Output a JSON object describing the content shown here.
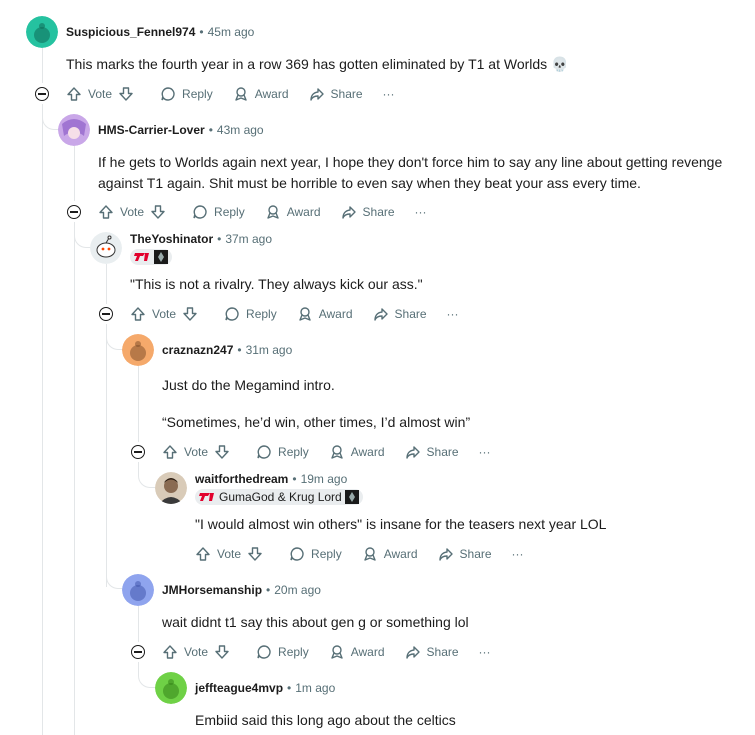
{
  "labels": {
    "vote": "Vote",
    "reply": "Reply",
    "award": "Award",
    "share": "Share",
    "more": "···"
  },
  "comments": [
    {
      "user": "Suspicious_Fennel974",
      "sep": "•",
      "time": "45m ago",
      "text": "This marks the fourth year in a row 369 has gotten eliminated by T1 at Worlds 💀",
      "avatar_color": "#25c2a0"
    },
    {
      "user": "HMS-Carrier-Lover",
      "sep": "•",
      "time": "43m ago",
      "text": "If he gets to Worlds again next year, I hope they don't force him to say any line about getting revenge against T1 again. Shit must be horrible to even say when they beat your ass every time.",
      "avatar_color": "#c9a7e8"
    },
    {
      "user": "TheYoshinator",
      "sep": "•",
      "time": "37m ago",
      "text": "\"This is not a rivalry. They always kick our ass.\"",
      "avatar_color": "#e9eef0"
    },
    {
      "user": "craznazn247",
      "sep": "•",
      "time": "31m ago",
      "text1": "Just do the Megamind intro.",
      "text2": "“Sometimes, he’d win, other times, I’d almost win”",
      "avatar_color": "#f5a96b"
    },
    {
      "user": "waitforthedream",
      "sep": "•",
      "time": "19m ago",
      "flair": "GumaGod & Krug Lord",
      "text": "\"I would almost win others\" is insane for the teasers next year LOL",
      "avatar_color": "#8a6b52"
    },
    {
      "user": "JMHorsemanship",
      "sep": "•",
      "time": "20m ago",
      "text": "wait didnt t1 say this about gen g or something lol",
      "avatar_color": "#8fa4ee"
    },
    {
      "user": "jeffteague4mvp",
      "sep": "•",
      "time": "1m ago",
      "text": "Embiid said this long ago about the celtics",
      "avatar_color": "#6fd146"
    }
  ],
  "colors": {
    "text": "#1c1c1c",
    "meta": "#576f76",
    "thread_line": "#e3e6e8",
    "t1_red": "#e2012d"
  }
}
